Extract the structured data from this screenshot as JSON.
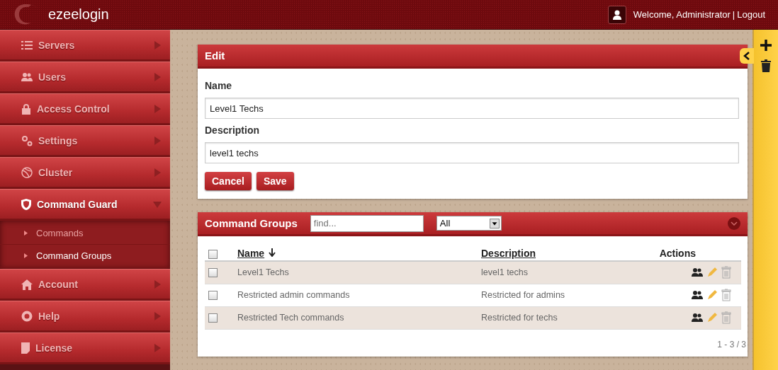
{
  "header": {
    "brand": "ezeelogin",
    "welcome": "Welcome, Administrator",
    "separator": "|",
    "logout": "Logout"
  },
  "sidebar": {
    "items": [
      {
        "label": "Servers",
        "selected": false,
        "expanded": false
      },
      {
        "label": "Users",
        "selected": false,
        "expanded": false
      },
      {
        "label": "Access Control",
        "selected": false,
        "expanded": false
      },
      {
        "label": "Settings",
        "selected": false,
        "expanded": false
      },
      {
        "label": "Cluster",
        "selected": false,
        "expanded": false
      },
      {
        "label": "Command Guard",
        "selected": true,
        "expanded": true,
        "children": [
          {
            "label": "Commands",
            "selected": false
          },
          {
            "label": "Command Groups",
            "selected": true
          }
        ]
      },
      {
        "label": "Account",
        "selected": false,
        "expanded": false
      },
      {
        "label": "Help",
        "selected": false,
        "expanded": false
      },
      {
        "label": "License",
        "selected": false,
        "expanded": false
      }
    ]
  },
  "edit": {
    "title": "Edit",
    "fields": [
      {
        "label": "Name",
        "value": "Level1 Techs"
      },
      {
        "label": "Description",
        "value": "level1 techs"
      }
    ],
    "buttons": [
      "Cancel",
      "Save"
    ]
  },
  "groups": {
    "title": "Command Groups",
    "search": {
      "placeholder": "find..."
    },
    "filter": "All",
    "columns": [
      {
        "label": "Name",
        "sorted": true
      },
      {
        "label": "Description",
        "sorted": false
      },
      {
        "label": "Actions",
        "sorted": false
      }
    ],
    "header_checked": false,
    "rows": [
      {
        "checked": false,
        "name": "Level1 Techs",
        "description": "level1 techs"
      },
      {
        "checked": false,
        "name": "Restricted admin commands",
        "description": "Restricted for admins"
      },
      {
        "checked": false,
        "name": "Restricted Tech commands",
        "description": "Restricted for techs"
      }
    ],
    "pager": "1 - 3 / 3"
  }
}
